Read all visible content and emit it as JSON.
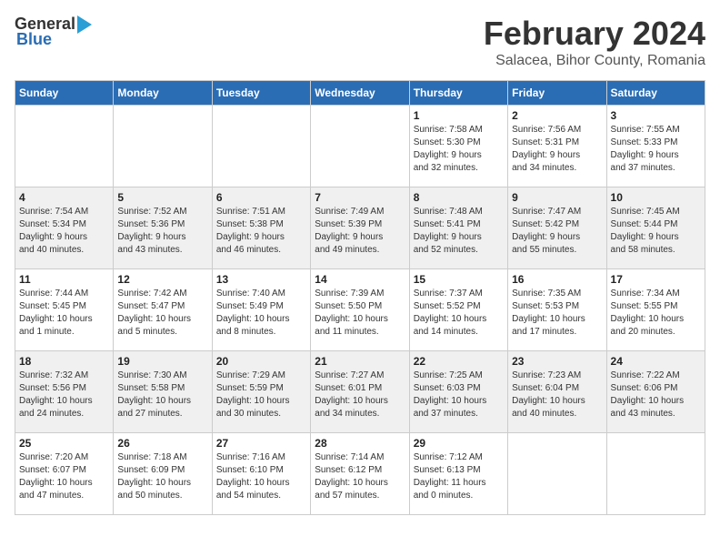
{
  "header": {
    "logo_general": "General",
    "logo_blue": "Blue",
    "main_title": "February 2024",
    "subtitle": "Salacea, Bihor County, Romania"
  },
  "weekdays": [
    "Sunday",
    "Monday",
    "Tuesday",
    "Wednesday",
    "Thursday",
    "Friday",
    "Saturday"
  ],
  "weeks": [
    [
      {
        "day": "",
        "info": ""
      },
      {
        "day": "",
        "info": ""
      },
      {
        "day": "",
        "info": ""
      },
      {
        "day": "",
        "info": ""
      },
      {
        "day": "1",
        "info": "Sunrise: 7:58 AM\nSunset: 5:30 PM\nDaylight: 9 hours\nand 32 minutes."
      },
      {
        "day": "2",
        "info": "Sunrise: 7:56 AM\nSunset: 5:31 PM\nDaylight: 9 hours\nand 34 minutes."
      },
      {
        "day": "3",
        "info": "Sunrise: 7:55 AM\nSunset: 5:33 PM\nDaylight: 9 hours\nand 37 minutes."
      }
    ],
    [
      {
        "day": "4",
        "info": "Sunrise: 7:54 AM\nSunset: 5:34 PM\nDaylight: 9 hours\nand 40 minutes."
      },
      {
        "day": "5",
        "info": "Sunrise: 7:52 AM\nSunset: 5:36 PM\nDaylight: 9 hours\nand 43 minutes."
      },
      {
        "day": "6",
        "info": "Sunrise: 7:51 AM\nSunset: 5:38 PM\nDaylight: 9 hours\nand 46 minutes."
      },
      {
        "day": "7",
        "info": "Sunrise: 7:49 AM\nSunset: 5:39 PM\nDaylight: 9 hours\nand 49 minutes."
      },
      {
        "day": "8",
        "info": "Sunrise: 7:48 AM\nSunset: 5:41 PM\nDaylight: 9 hours\nand 52 minutes."
      },
      {
        "day": "9",
        "info": "Sunrise: 7:47 AM\nSunset: 5:42 PM\nDaylight: 9 hours\nand 55 minutes."
      },
      {
        "day": "10",
        "info": "Sunrise: 7:45 AM\nSunset: 5:44 PM\nDaylight: 9 hours\nand 58 minutes."
      }
    ],
    [
      {
        "day": "11",
        "info": "Sunrise: 7:44 AM\nSunset: 5:45 PM\nDaylight: 10 hours\nand 1 minute."
      },
      {
        "day": "12",
        "info": "Sunrise: 7:42 AM\nSunset: 5:47 PM\nDaylight: 10 hours\nand 5 minutes."
      },
      {
        "day": "13",
        "info": "Sunrise: 7:40 AM\nSunset: 5:49 PM\nDaylight: 10 hours\nand 8 minutes."
      },
      {
        "day": "14",
        "info": "Sunrise: 7:39 AM\nSunset: 5:50 PM\nDaylight: 10 hours\nand 11 minutes."
      },
      {
        "day": "15",
        "info": "Sunrise: 7:37 AM\nSunset: 5:52 PM\nDaylight: 10 hours\nand 14 minutes."
      },
      {
        "day": "16",
        "info": "Sunrise: 7:35 AM\nSunset: 5:53 PM\nDaylight: 10 hours\nand 17 minutes."
      },
      {
        "day": "17",
        "info": "Sunrise: 7:34 AM\nSunset: 5:55 PM\nDaylight: 10 hours\nand 20 minutes."
      }
    ],
    [
      {
        "day": "18",
        "info": "Sunrise: 7:32 AM\nSunset: 5:56 PM\nDaylight: 10 hours\nand 24 minutes."
      },
      {
        "day": "19",
        "info": "Sunrise: 7:30 AM\nSunset: 5:58 PM\nDaylight: 10 hours\nand 27 minutes."
      },
      {
        "day": "20",
        "info": "Sunrise: 7:29 AM\nSunset: 5:59 PM\nDaylight: 10 hours\nand 30 minutes."
      },
      {
        "day": "21",
        "info": "Sunrise: 7:27 AM\nSunset: 6:01 PM\nDaylight: 10 hours\nand 34 minutes."
      },
      {
        "day": "22",
        "info": "Sunrise: 7:25 AM\nSunset: 6:03 PM\nDaylight: 10 hours\nand 37 minutes."
      },
      {
        "day": "23",
        "info": "Sunrise: 7:23 AM\nSunset: 6:04 PM\nDaylight: 10 hours\nand 40 minutes."
      },
      {
        "day": "24",
        "info": "Sunrise: 7:22 AM\nSunset: 6:06 PM\nDaylight: 10 hours\nand 43 minutes."
      }
    ],
    [
      {
        "day": "25",
        "info": "Sunrise: 7:20 AM\nSunset: 6:07 PM\nDaylight: 10 hours\nand 47 minutes."
      },
      {
        "day": "26",
        "info": "Sunrise: 7:18 AM\nSunset: 6:09 PM\nDaylight: 10 hours\nand 50 minutes."
      },
      {
        "day": "27",
        "info": "Sunrise: 7:16 AM\nSunset: 6:10 PM\nDaylight: 10 hours\nand 54 minutes."
      },
      {
        "day": "28",
        "info": "Sunrise: 7:14 AM\nSunset: 6:12 PM\nDaylight: 10 hours\nand 57 minutes."
      },
      {
        "day": "29",
        "info": "Sunrise: 7:12 AM\nSunset: 6:13 PM\nDaylight: 11 hours\nand 0 minutes."
      },
      {
        "day": "",
        "info": ""
      },
      {
        "day": "",
        "info": ""
      }
    ]
  ]
}
